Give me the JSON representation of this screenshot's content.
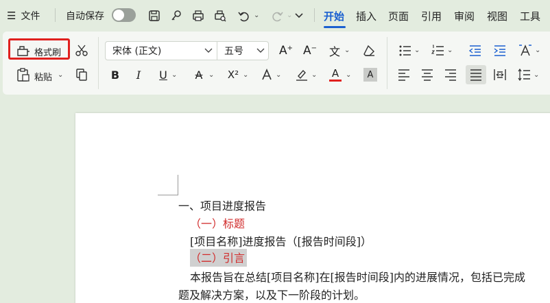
{
  "menubar": {
    "menu_label": "文件",
    "autosave_label": "自动保存",
    "autosave_on": false,
    "tabs": [
      "开始",
      "插入",
      "页面",
      "引用",
      "审阅",
      "视图",
      "工具"
    ],
    "active_tab": "开始"
  },
  "ribbon": {
    "format_painter": "格式刷",
    "paste": "粘贴",
    "font_name": "宋体 (正文)",
    "font_size": "五号",
    "superscript": "X²",
    "bold": "B",
    "italic": "I",
    "underline": "U",
    "strike": "A",
    "font_color_letter": "A",
    "shade_letter": "A",
    "grow": "A",
    "shrink": "A",
    "phonetic": "文"
  },
  "colors": {
    "accent": "#1a5fd0",
    "highlight_box": "#e0201e",
    "heading_red": "#d12b2b",
    "font_color_bar": "#e0201e"
  },
  "document": {
    "lines": [
      "一、项目进度报告",
      "（一）标题",
      "[项目名称]进度报告（[报告时间段]）",
      "（二）引言",
      "本报告旨在总结[项目名称]在[报告时间段]内的进展情况，包括已完成",
      "题及解决方案，以及下一阶段的计划。"
    ]
  }
}
